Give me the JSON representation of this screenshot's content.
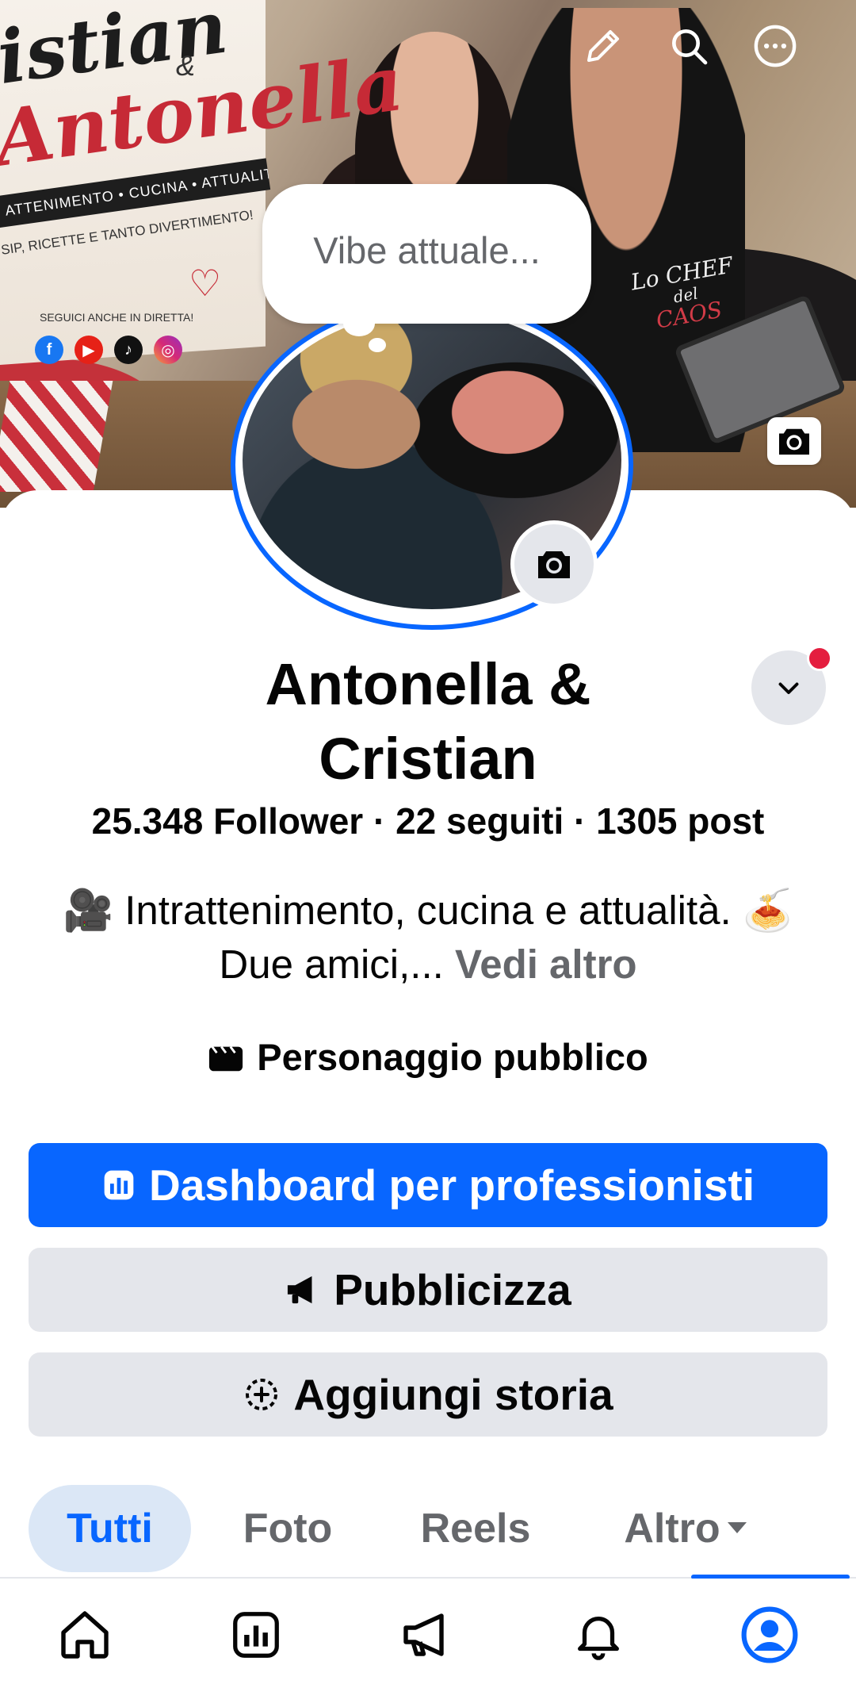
{
  "cover": {
    "title_line1": "istian",
    "title_amp": "&",
    "title_line2": "Antonella",
    "band": "ATTENIMENTO • CUCINA • ATTUALITÀ",
    "tagline": "SIP, RICETTE E TANTO DIVERTIMENTO!",
    "follow": "SEGUICI ANCHE IN DIRETTA!",
    "apron_line1": "Lo CHEF",
    "apron_line2": "del",
    "apron_line3": "CAOS"
  },
  "top_actions": [
    "edit-icon",
    "search-icon",
    "more-icon"
  ],
  "vibe_placeholder": "Vibe attuale...",
  "profile": {
    "name": "Antonella & Cristian",
    "stats": "25.348 Follower · 22 seguiti · 1305 post",
    "bio_text": "🎥 Intrattenimento, cucina e attualità. 🍝 Due amici,...",
    "bio_more": "Vedi altro",
    "category": "Personaggio pubblico"
  },
  "buttons": {
    "dashboard": "Dashboard per professionisti",
    "promote": "Pubblicizza",
    "add_story": "Aggiungi storia"
  },
  "tabs": [
    {
      "label": "Tutti",
      "active": true
    },
    {
      "label": "Foto",
      "active": false
    },
    {
      "label": "Reels",
      "active": false
    },
    {
      "label": "Altro",
      "active": false
    }
  ],
  "bottom_nav": [
    "home-icon",
    "dashboard-icon",
    "megaphone-icon",
    "bell-icon",
    "profile-icon"
  ],
  "colors": {
    "accent": "#0866ff",
    "secondary_button": "#e4e6eb",
    "muted_text": "#65676b",
    "notification_dot": "#e41e3f"
  }
}
